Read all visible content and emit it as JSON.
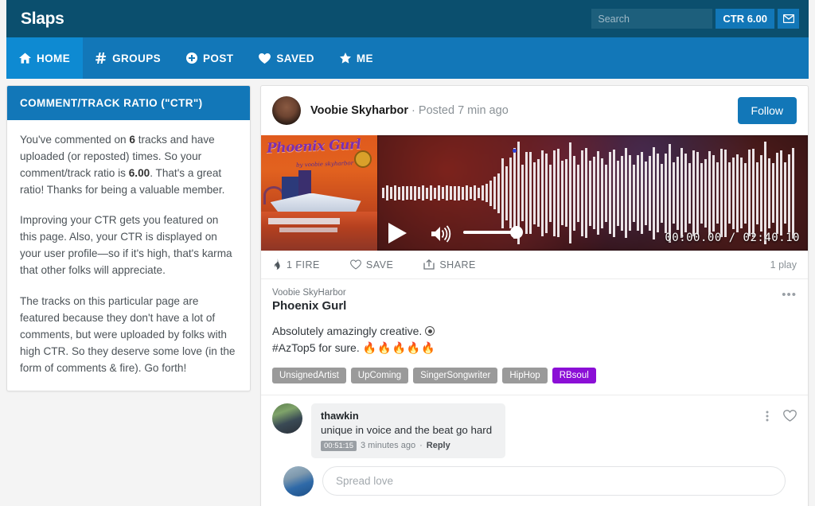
{
  "app": {
    "brand": "Slaps"
  },
  "topbar": {
    "search_placeholder": "Search",
    "search_value": "",
    "ctr_badge": "CTR 6.00",
    "messages_icon": "envelope-icon"
  },
  "nav": {
    "items": [
      {
        "label": "HOME",
        "icon": "home-icon",
        "active": true
      },
      {
        "label": "GROUPS",
        "icon": "hash-icon",
        "active": false
      },
      {
        "label": "POST",
        "icon": "plus-circle-icon",
        "active": false
      },
      {
        "label": "SAVED",
        "icon": "heart-icon",
        "active": false
      },
      {
        "label": "ME",
        "icon": "star-icon",
        "active": false
      }
    ]
  },
  "sidebar": {
    "title": "COMMENT/TRACK RATIO (\"CTR\")",
    "paragraph1_a": "You've commented on ",
    "paragraph1_b": "6",
    "paragraph1_c": " tracks and have uploaded (or reposted) times. So your comment/track ratio is ",
    "paragraph1_d": "6.00",
    "paragraph1_e": ". That's a great ratio! Thanks for being a valuable member.",
    "paragraph2": "Improving your CTR gets you featured on this page. Also, your CTR is displayed on your user profile—so if it's high, that's karma that other folks will appreciate.",
    "paragraph3": "The tracks on this particular page are featured because they don't have a lot of comments, but were uploaded by folks with high CTR. So they deserve some love (in the form of comments & fire). Go forth!"
  },
  "post": {
    "author": "Voobie Skyharbor",
    "posted": "· Posted 7 min ago",
    "follow_label": "Follow",
    "album_title": "Phoenix Gurl",
    "album_subtitle": "by voobie skyharbor",
    "player": {
      "time_current": "00:00.00",
      "time_total": "02:40.10",
      "time_display": "00:00.00 / 02:40.10",
      "play_icon": "play-icon",
      "volume_icon": "volume-icon"
    },
    "actions": {
      "fire": "1 FIRE",
      "save": "SAVE",
      "share": "SHARE",
      "plays": "1 play"
    },
    "track": {
      "artist": "Voobie SkyHarbor",
      "title": "Phoenix Gurl",
      "desc_line1": "Absolutely amazingly creative.",
      "desc_line2_a": "#AzTop5 for sure. ",
      "desc_line2_fire": "🔥🔥🔥🔥🔥",
      "menu": "•••",
      "tags": [
        {
          "label": "UnsignedArtist",
          "accent": false
        },
        {
          "label": "UpComing",
          "accent": false
        },
        {
          "label": "SingerSongwriter",
          "accent": false
        },
        {
          "label": "HipHop",
          "accent": false
        },
        {
          "label": "RBsoul",
          "accent": true
        }
      ]
    },
    "comments": [
      {
        "user": "thawkin",
        "text": "unique in voice and the beat go hard",
        "stamp": "00:51:15",
        "time": "3 minutes ago",
        "sep": "·",
        "reply": "Reply"
      }
    ],
    "composer_placeholder": "Spread love",
    "composer_value": ""
  },
  "colors": {
    "header_dark": "#0b4f6e",
    "nav_blue": "#1277b8",
    "nav_active": "#0e8ad2",
    "tag_accent": "#8b0fd6",
    "page_bg": "#f4f4f4"
  }
}
